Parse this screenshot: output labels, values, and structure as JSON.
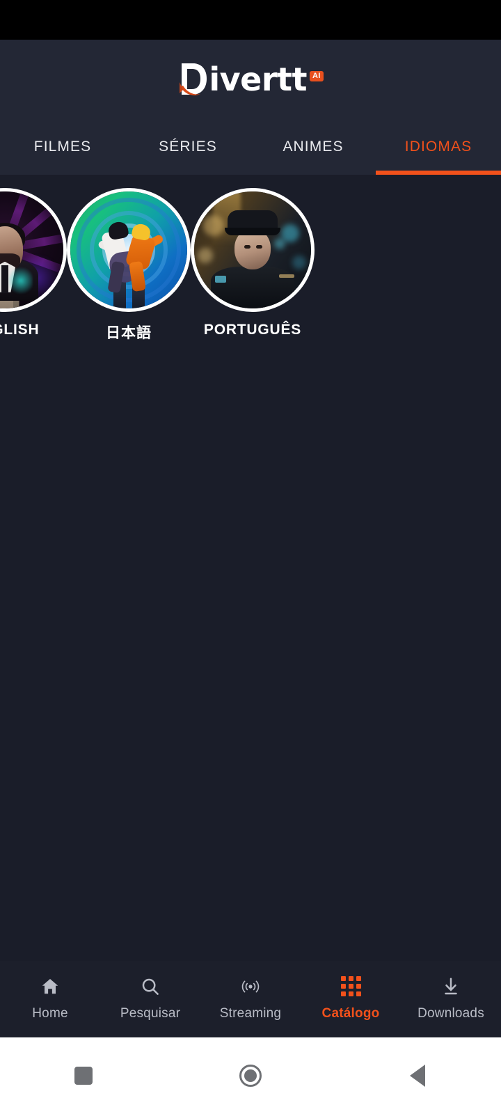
{
  "app": {
    "logo_text": "ivertt",
    "logo_initial": "D",
    "logo_badge": "AI"
  },
  "tabs": [
    {
      "label": "FILMES",
      "active": false
    },
    {
      "label": "SÉRIES",
      "active": false
    },
    {
      "label": "ANIMES",
      "active": false
    },
    {
      "label": "IDIOMAS",
      "active": true
    }
  ],
  "languages": [
    {
      "label": "ENGLISH",
      "art": "john-wick-poster"
    },
    {
      "label": "日本語",
      "art": "naruto-sasuke-poster"
    },
    {
      "label": "PORTUGUÊS",
      "art": "tropa-de-elite-poster"
    }
  ],
  "bottom_nav": [
    {
      "label": "Home",
      "icon": "home-icon",
      "active": false
    },
    {
      "label": "Pesquisar",
      "icon": "search-icon",
      "active": false
    },
    {
      "label": "Streaming",
      "icon": "broadcast-icon",
      "active": false
    },
    {
      "label": "Catálogo",
      "icon": "grid-icon",
      "active": true
    },
    {
      "label": "Downloads",
      "icon": "download-icon",
      "active": false
    }
  ],
  "system_nav": [
    {
      "name": "recents-button",
      "icon": "square-icon"
    },
    {
      "name": "home-button",
      "icon": "circle-icon"
    },
    {
      "name": "back-button",
      "icon": "triangle-left-icon"
    }
  ],
  "colors": {
    "accent": "#f2511b",
    "background": "#1a1d29",
    "header": "#232735",
    "nav_background": "#1c1f2b",
    "text_primary": "#ffffff",
    "text_muted": "#b9bcc6",
    "system_nav_background": "#ffffff",
    "status_bar": "#000000"
  }
}
